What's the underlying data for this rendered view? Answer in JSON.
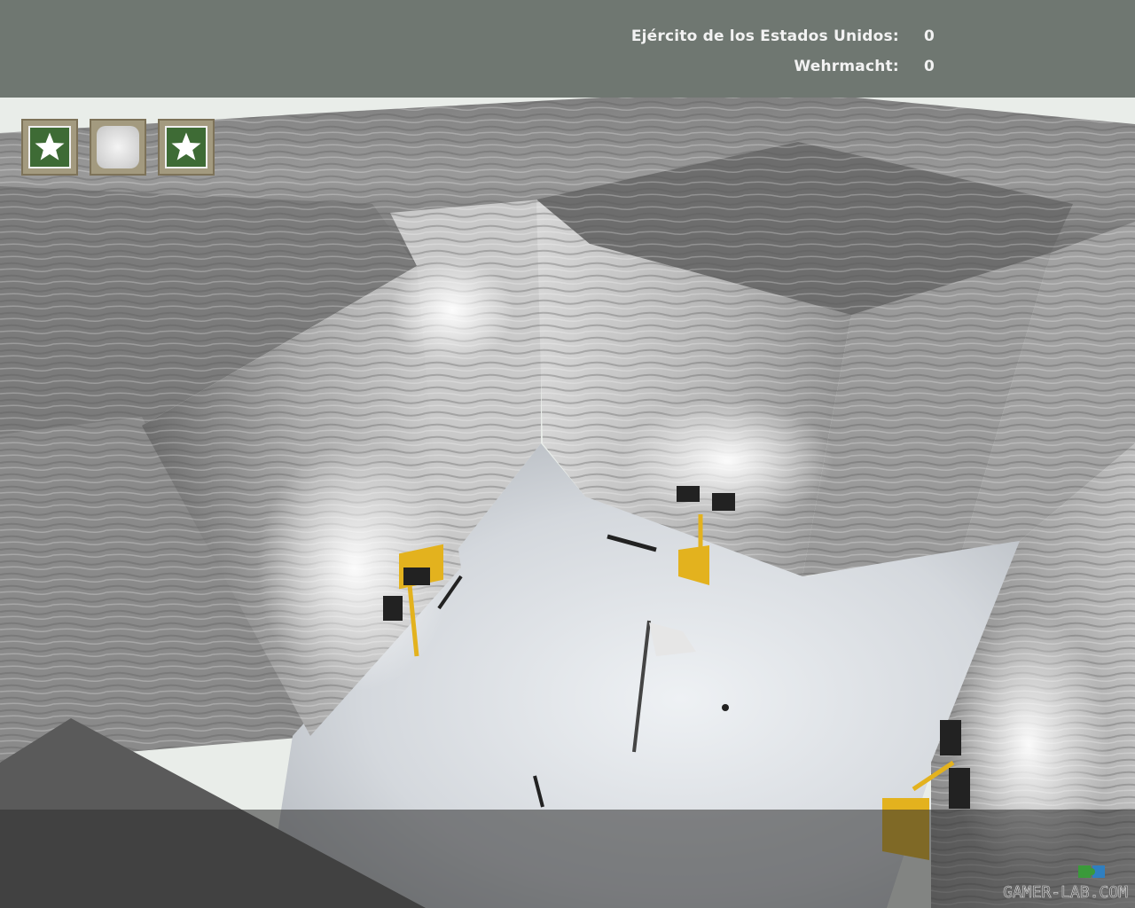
{
  "hud": {
    "scoreboard": [
      {
        "team": "Ejército de los Estados Unidos:",
        "score": "0"
      },
      {
        "team": "Wehrmacht:",
        "score": "0"
      }
    ],
    "flags": [
      {
        "owner": "us",
        "icon": "star-icon"
      },
      {
        "owner": "neutral",
        "icon": "neutral-flag-icon"
      },
      {
        "owner": "us",
        "icon": "star-icon"
      }
    ]
  },
  "watermark": {
    "text": "GAMER-LAB.COM",
    "icon": "puzzle-piece-icon"
  },
  "colors": {
    "hud_bar": "#6f7771",
    "us_green": "#3e6b35",
    "slot_frame": "#a39a7f",
    "lamp_yellow": "#e3b21e"
  }
}
